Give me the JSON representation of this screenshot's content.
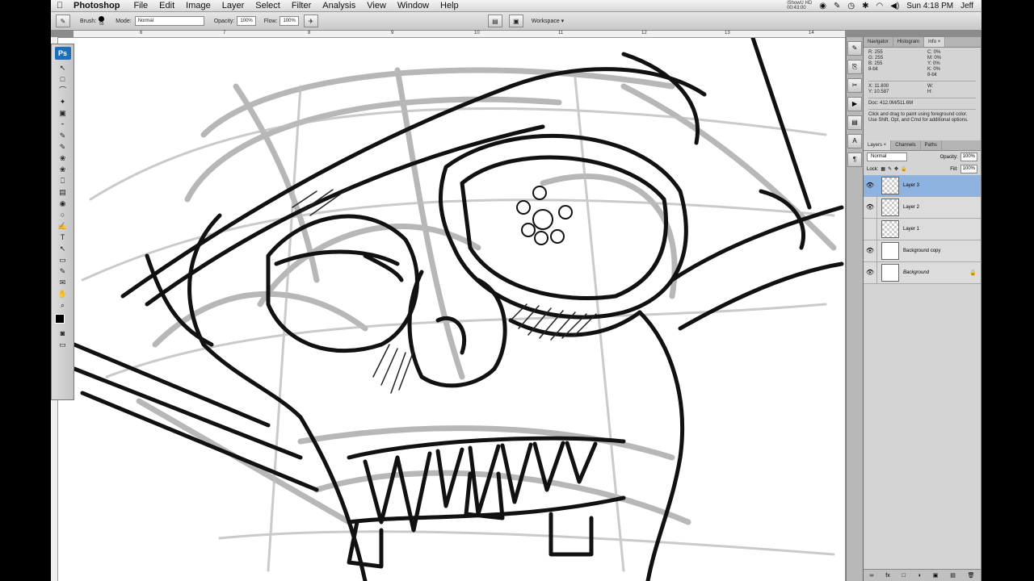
{
  "menubar": {
    "apple": "",
    "app_name": "Photoshop",
    "menus": [
      "File",
      "Edit",
      "Image",
      "Layer",
      "Select",
      "Filter",
      "Analysis",
      "View",
      "Window",
      "Help"
    ],
    "ishowu_label": "iShowU HD",
    "ishowu_time": "00:43:00",
    "clock": "Sun 4:18 PM",
    "user": "Jeff"
  },
  "options": {
    "brush_label": "Brush:",
    "brush_size": "55",
    "mode_label": "Mode:",
    "mode_value": "Normal",
    "opacity_label": "Opacity:",
    "opacity_value": "100%",
    "flow_label": "Flow:",
    "flow_value": "100%",
    "workspace_label": "Workspace ▾"
  },
  "ruler": [
    "6",
    "7",
    "8",
    "9",
    "10",
    "11",
    "12",
    "13",
    "14"
  ],
  "toolbox": {
    "ps": "Ps",
    "tools": [
      "↖",
      "□",
      "⌒",
      "✦",
      "▣",
      "⁃",
      "✎",
      "✎",
      "❀",
      "❀",
      "⎕",
      "▤",
      "◉",
      "○",
      "✍",
      "T",
      "↖",
      "▭",
      "✎",
      "✉",
      "✋",
      "⌕"
    ]
  },
  "panels": {
    "info_tabs": [
      "Navigator",
      "Histogram",
      "Info ×"
    ],
    "info": {
      "r": "R:",
      "g": "G:",
      "b": "B:",
      "r_val": "255",
      "g_val": "255",
      "b_val": "255",
      "c": "C:",
      "m": "M:",
      "y": "Y:",
      "k": "K:",
      "c_val": "0%",
      "m_val": "0%",
      "y_val": "0%",
      "k_val": "0%",
      "bit1": "8-bit",
      "bit2": "8-bit",
      "x": "X:",
      "y_coord": "Y:",
      "x_val": "11.800",
      "y_val_coord": "10.587",
      "w": "W:",
      "h": "H:",
      "doc": "Doc: 412.0M/511.6M",
      "help": "Click and drag to paint using foreground color. Use Shift, Opt, and Cmd for additional options."
    },
    "layer_tabs": [
      "Layers ×",
      "Channels",
      "Paths"
    ],
    "blend_mode": "Normal",
    "opacity_label": "Opacity:",
    "opacity": "100%",
    "lock_label": "Lock:",
    "fill_label": "Fill:",
    "fill": "100%",
    "layers": [
      {
        "name": "Layer 3",
        "visible": "👁",
        "active": true
      },
      {
        "name": "Layer 2",
        "visible": "👁",
        "active": false
      },
      {
        "name": "Layer 1",
        "visible": "",
        "active": false
      },
      {
        "name": "Background copy",
        "visible": "👁",
        "active": false
      },
      {
        "name": "Background",
        "visible": "👁",
        "active": false,
        "locked": "🔒"
      }
    ],
    "footer_icons": [
      "∞",
      "fx",
      "□",
      "◑",
      "▣",
      "▤",
      "🗑"
    ]
  }
}
